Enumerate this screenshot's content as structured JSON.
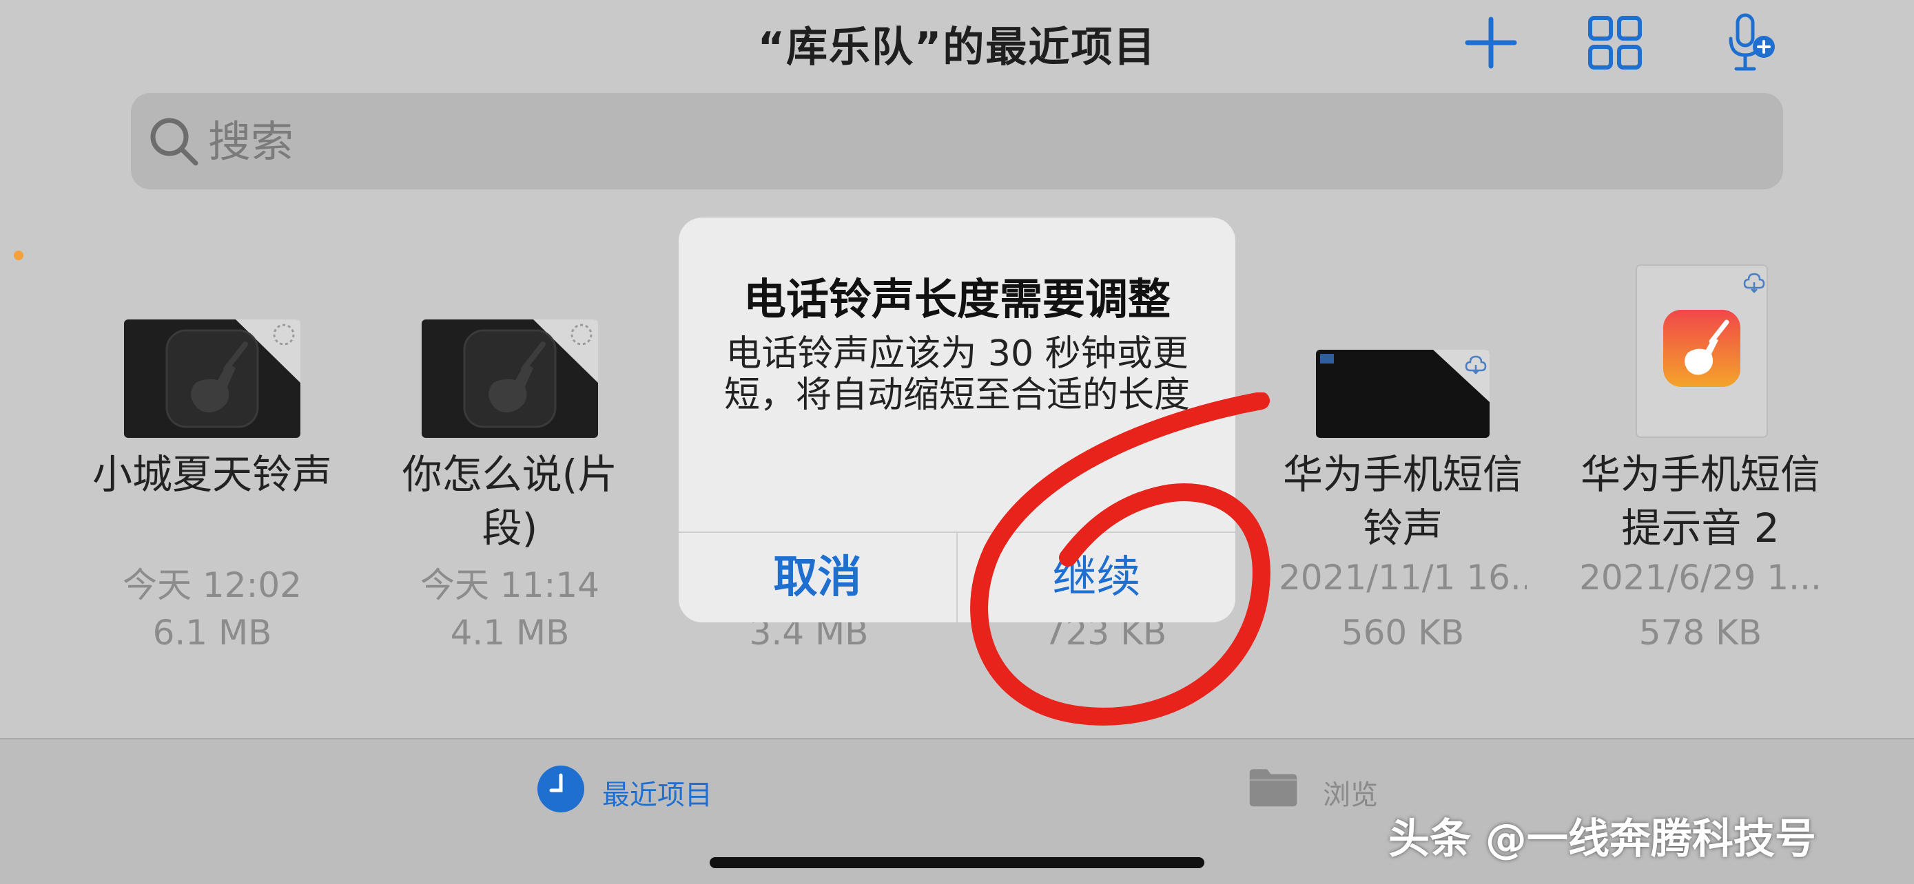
{
  "header": {
    "title": "“库乐队”的最近项目",
    "icons": [
      "plus-icon",
      "grid-icon",
      "microphone-add-icon"
    ]
  },
  "search": {
    "placeholder": "搜索"
  },
  "files": [
    {
      "name": "小城夏天铃声",
      "date": "今天 12:02",
      "size": "6.1 MB",
      "thumb": "dark-garageband"
    },
    {
      "name": "你怎么说(片段)",
      "date": "今天 11:14",
      "size": "4.1 MB",
      "thumb": "dark-garageband"
    },
    {
      "name": "",
      "date": "",
      "size": "3.4 MB",
      "thumb": "hidden"
    },
    {
      "name": "",
      "date": "",
      "size": "723 KB",
      "thumb": "hidden"
    },
    {
      "name": "华为手机短信铃声",
      "date": "2021/11/1 16...",
      "size": "560 KB",
      "thumb": "dark-cloud"
    },
    {
      "name": "华为手机短信提示音 2",
      "date": "2021/6/29 1...",
      "size": "578 KB",
      "thumb": "garageband-app"
    }
  ],
  "alert": {
    "title": "电话铃声长度需要调整",
    "message": "电话铃声应该为 30 秒钟或更短，将自动缩短至合适的长度",
    "cancel": "取消",
    "continue": "继续"
  },
  "tabs": [
    {
      "label": "最近项目",
      "icon": "clock-icon",
      "active": true,
      "color": "#1f6fd1"
    },
    {
      "label": "浏览",
      "icon": "folder-icon",
      "active": false,
      "color": "#8a8a8a"
    }
  ],
  "watermark": "头条 @一线奔腾科技号",
  "colors": {
    "accent": "#1f6fd1",
    "annotation": "#e8231c"
  }
}
